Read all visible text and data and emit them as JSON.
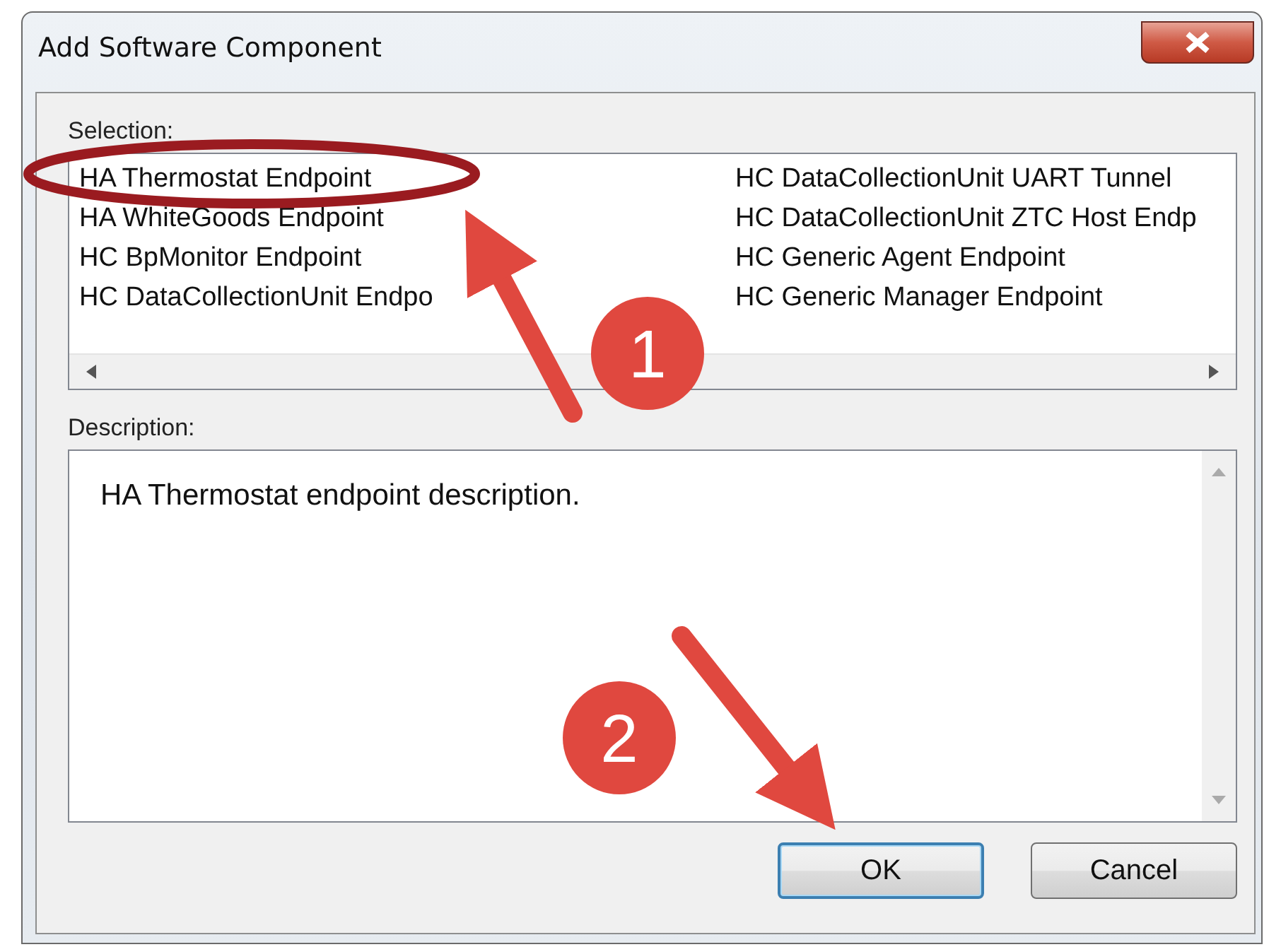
{
  "window": {
    "title": "Add Software Component"
  },
  "selection": {
    "label": "Selection:",
    "items": [
      "HA Thermostat Endpoint",
      "HA WhiteGoods Endpoint",
      "HC BpMonitor Endpoint",
      "HC DataCollectionUnit Endpo",
      "HC DataCollectionUnit UART Tunnel",
      "HC DataCollectionUnit ZTC Host Endp",
      "HC Generic Agent Endpoint",
      "HC Generic Manager Endpoint"
    ]
  },
  "description": {
    "label": "Description:",
    "text": "HA Thermostat endpoint description."
  },
  "buttons": [
    {
      "label": "OK",
      "default": true
    },
    {
      "label": "Cancel",
      "default": false
    }
  ],
  "callouts": [
    {
      "number": "1"
    },
    {
      "number": "2"
    }
  ]
}
